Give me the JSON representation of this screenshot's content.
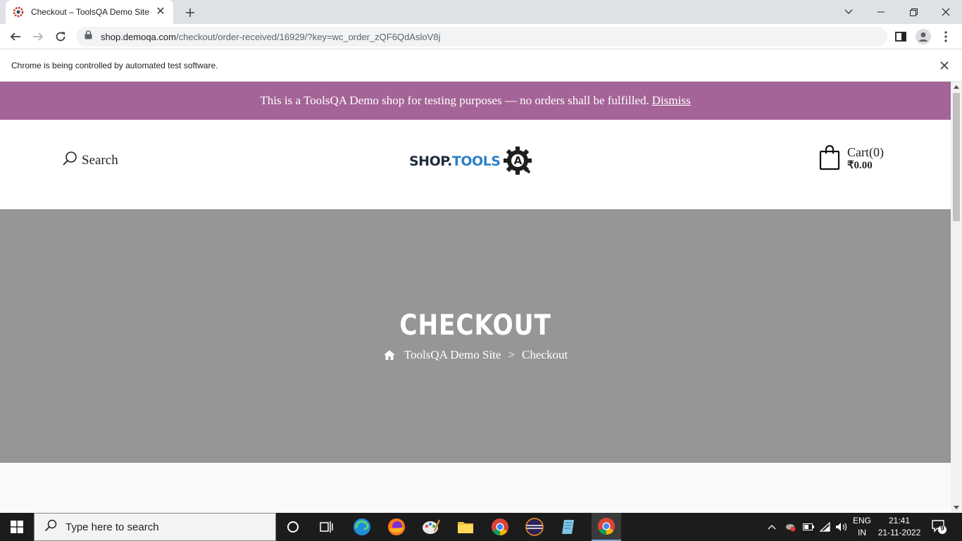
{
  "browser": {
    "tab_title": "Checkout – ToolsQA Demo Site",
    "url_host": "shop.demoqa.com",
    "url_path": "/checkout/order-received/16929/?key=wc_order_zQF6QdAsloV8j",
    "infobar_text": "Chrome is being controlled by automated test software."
  },
  "notice": {
    "text": "This is a ToolsQA Demo shop for testing purposes — no orders shall be fulfilled.",
    "dismiss_label": "Dismiss",
    "background_color": "#a46497"
  },
  "header": {
    "search_label": "Search",
    "logo_shop": "SHOP.",
    "logo_tools": "TOOLS",
    "logo_badge": "A",
    "cart_label": "Cart(0)",
    "cart_amount": "₹0.00"
  },
  "hero": {
    "title": "CHECKOUT",
    "breadcrumb_home": "ToolsQA Demo Site",
    "breadcrumb_separator": ">",
    "breadcrumb_current": "Checkout",
    "background_color": "#969696"
  },
  "taskbar": {
    "search_placeholder": "Type here to search",
    "lang_top": "ENG",
    "lang_bottom": "IN",
    "time": "21:41",
    "date": "21-11-2022",
    "notification_count": "9"
  }
}
